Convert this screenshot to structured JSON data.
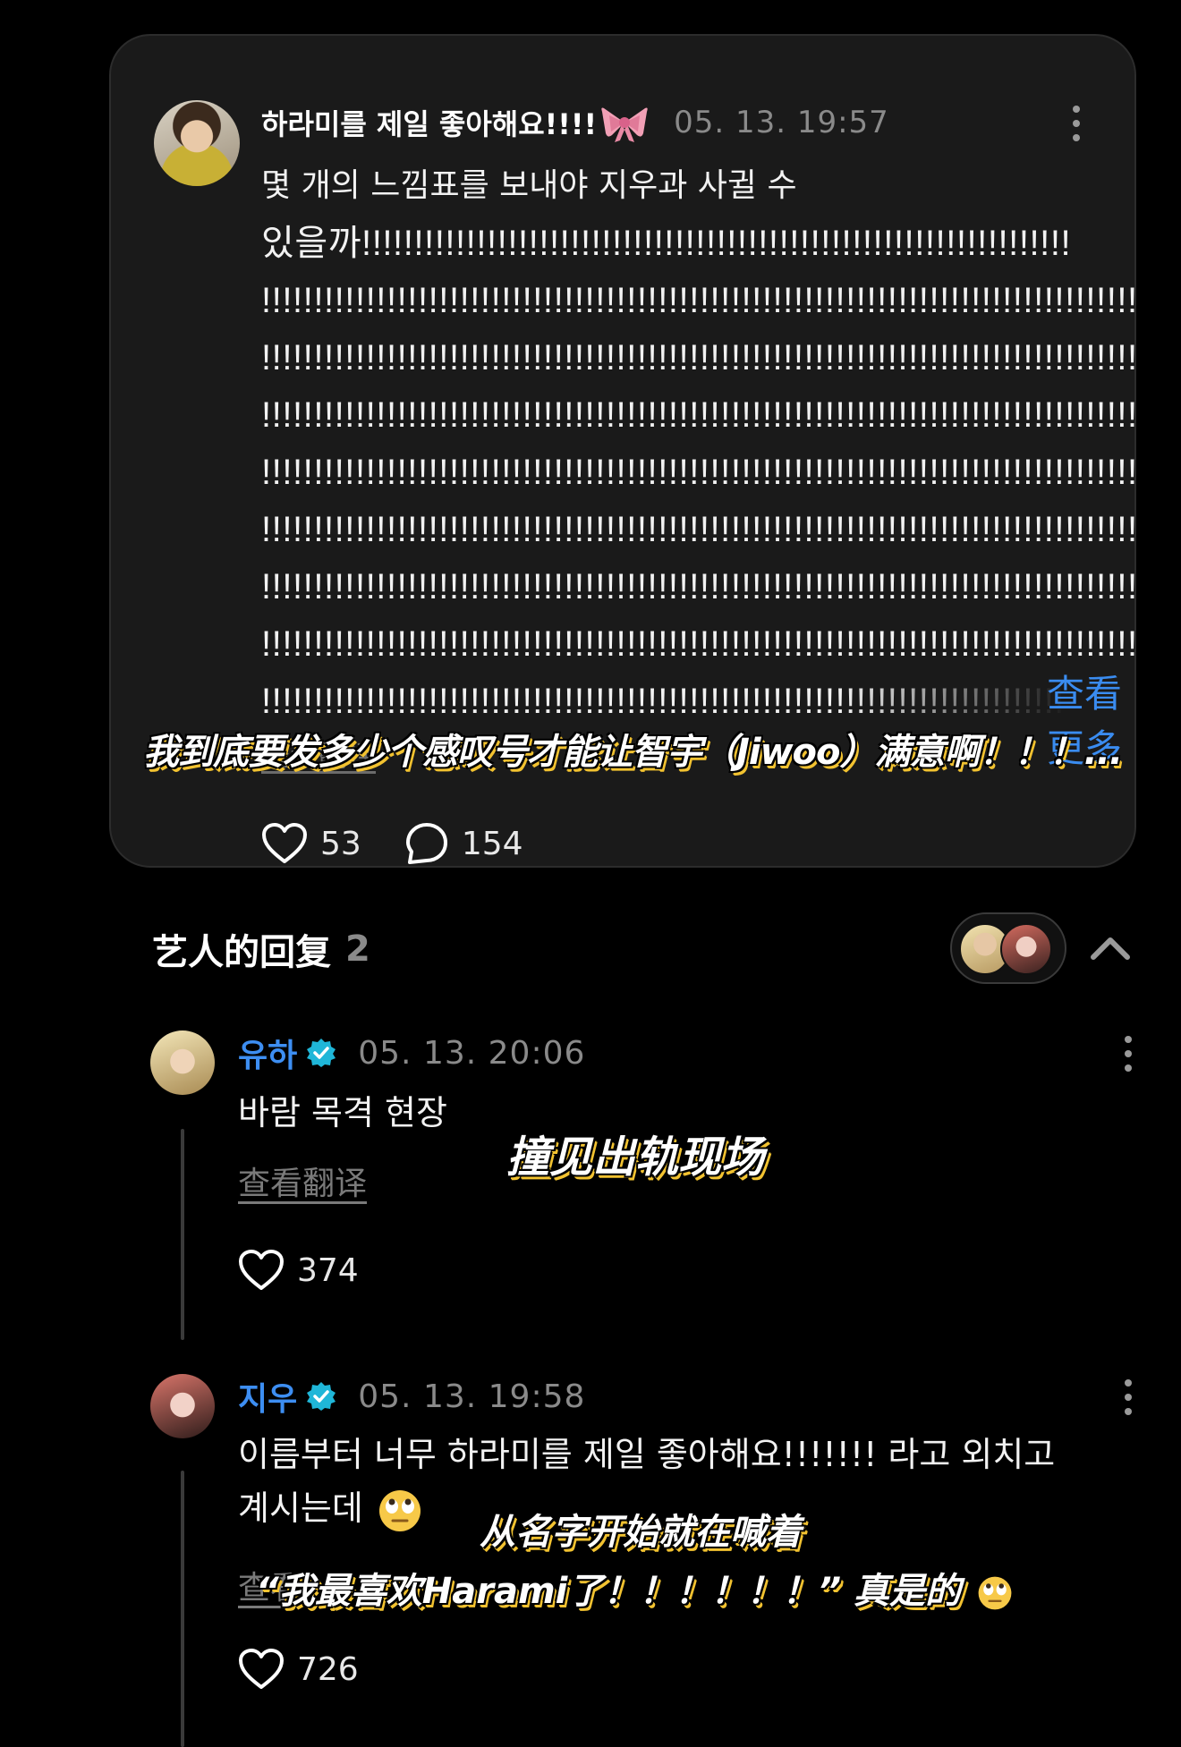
{
  "post": {
    "author": "하라미를 제일 좋아해요!!!!",
    "author_emoji": "bow",
    "timestamp": "05. 13. 19:57",
    "text_first_line": "몇 개의 느낌표를 보내야 지우과 사귈 수",
    "text_second_line": "있을까!!!!!!!!!!!!!!!!!!!!!!!!!!!!!!!!!!!!!!!!!!!!!!!!!!!!!!!!!!!!!!!!!!!!",
    "exclaim_line": "!!!!!!!!!!!!!!!!!!!!!!!!!!!!!!!!!!!!!!!!!!!!!!!!!!!!!!!!!!!!!!!!!!!!!!!!!!!!!!!!!!!!!!!!!!!!!!!",
    "see_more": "查看更多",
    "translate_label": "查看翻译",
    "subtitle": "我到底要发多少个感叹号才能让智宇（Jiwoo）满意啊！！！...",
    "likes": "53",
    "comments": "154"
  },
  "replies_section": {
    "title": "艺人的回复",
    "count": "2"
  },
  "replies": [
    {
      "name": "유하",
      "timestamp": "05. 13. 20:06",
      "text": "바람 목격 현장",
      "translate_label": "查看翻译",
      "subtitle": "撞见出轨现场",
      "likes": "374"
    },
    {
      "name": "지우",
      "timestamp": "05. 13. 19:58",
      "text_line1": "이름부터 너무 하라미를 제일 좋아해요!!!!!!! 라고 외치고",
      "text_line2": "계시는데",
      "translate_label": "查看翻译",
      "subtitle_line1": "从名字开始就在喊着",
      "subtitle_line2": "“我最喜欢Harami了！！！！！！” 真是的",
      "likes": "726"
    }
  ],
  "colors": {
    "background": "#000000",
    "card": "#1a1a1a",
    "accent_blue": "#3d8ef2",
    "caption_shadow": "#f2c230",
    "muted": "#8a8a8a"
  },
  "icons": [
    "heart-icon",
    "comment-icon",
    "more-icon",
    "verified-icon",
    "chevron-up-icon",
    "bow-emoji",
    "eye-roll-emoji"
  ]
}
